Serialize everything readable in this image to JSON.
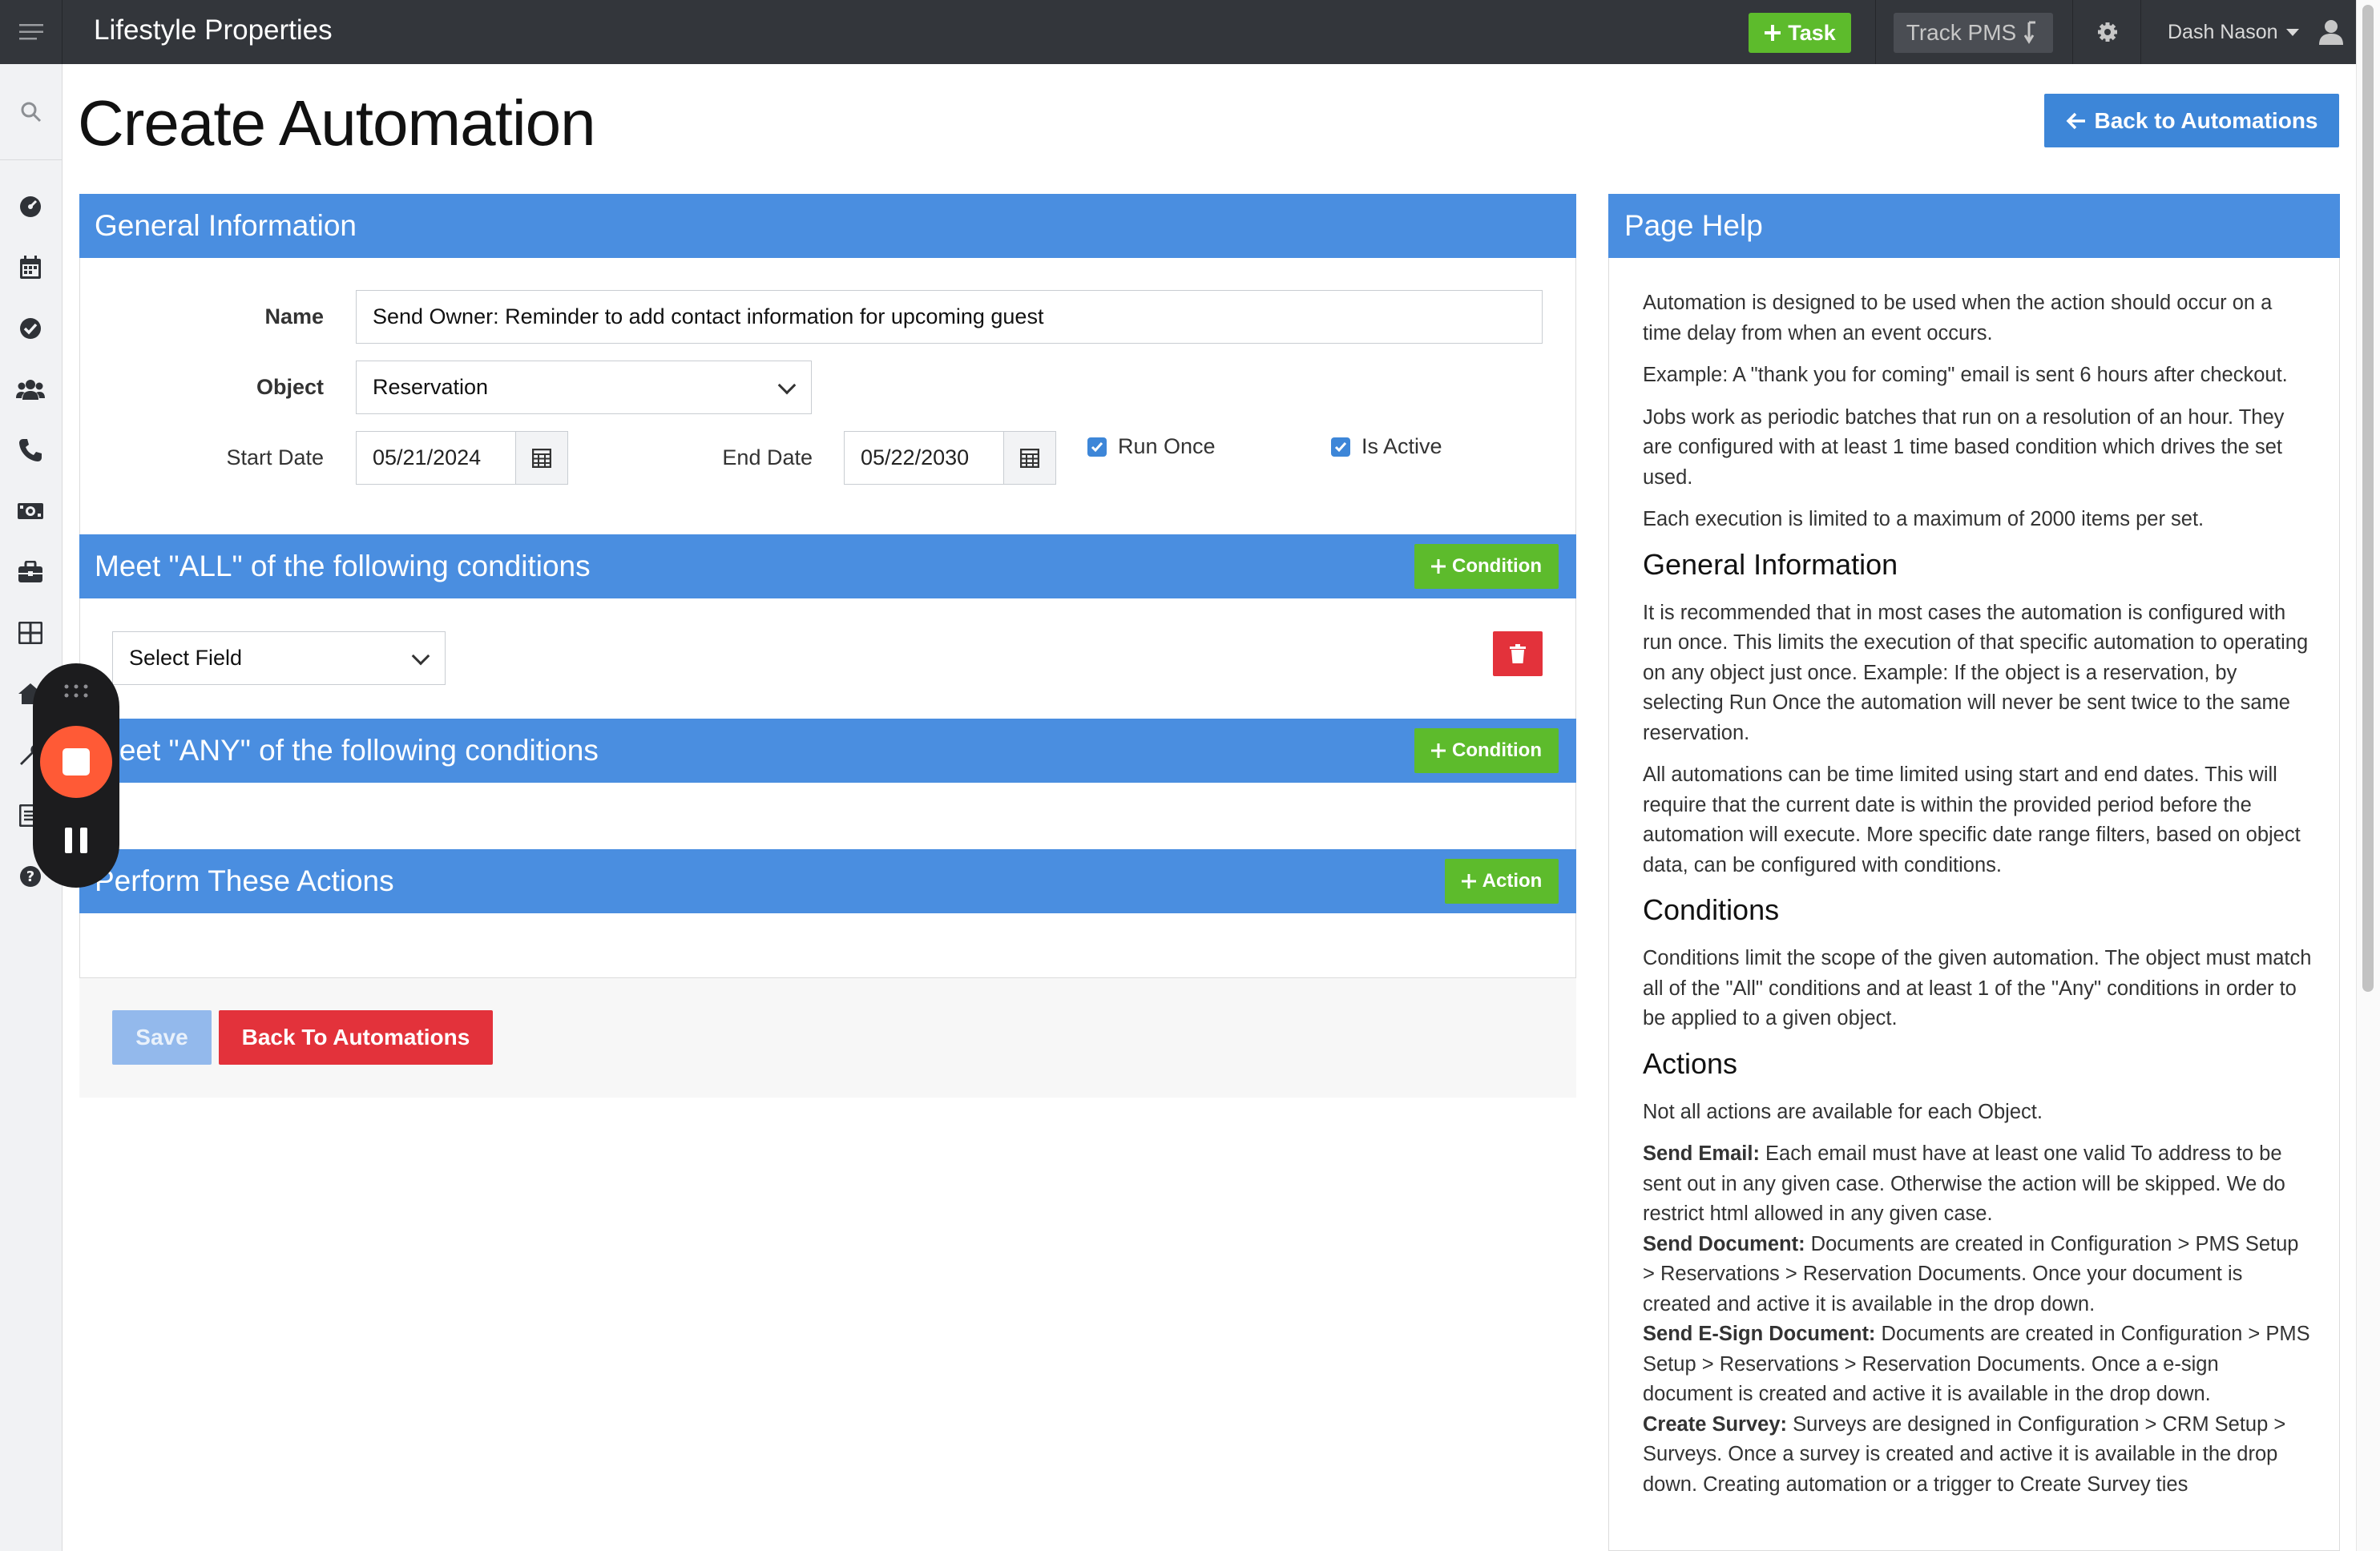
{
  "app": {
    "brand": "Lifestyle Properties",
    "task_label": "Task",
    "track_label": "Track PMS",
    "user_name": "Dash Nason"
  },
  "page": {
    "title": "Create Automation",
    "back_button": "Back to Automations"
  },
  "general": {
    "header": "General Information",
    "name_label": "Name",
    "name_value": "Send Owner: Reminder to add contact information for upcoming guest",
    "object_label": "Object",
    "object_value": "Reservation",
    "start_label": "Start Date",
    "start_value": "05/21/2024",
    "end_label": "End Date",
    "end_value": "05/22/2030",
    "run_once_label": "Run Once",
    "run_once_checked": true,
    "is_active_label": "Is Active",
    "is_active_checked": true
  },
  "conditions_all": {
    "header": "Meet \"ALL\" of the following conditions",
    "add_label": "Condition",
    "field_select": "Select Field"
  },
  "conditions_any": {
    "header": "Meet \"ANY\" of the following conditions",
    "add_label": "Condition"
  },
  "actions": {
    "header": "Perform These Actions",
    "add_label": "Action"
  },
  "footer": {
    "save_label": "Save",
    "back_label": "Back To Automations"
  },
  "help": {
    "header": "Page Help",
    "intro": [
      "Automation is designed to be used when the action should occur on a time delay from when an event occurs.",
      "Example: A \"thank you for coming\" email is sent 6 hours after checkout.",
      "Jobs work as periodic batches that run on a resolution of an hour. They are configured with at least 1 time based condition which drives the set used.",
      "Each execution is limited to a maximum of 2000 items per set."
    ],
    "general_title": "General Information",
    "general_text": [
      "It is recommended that in most cases the automation is configured with run once. This limits the execution of that specific automation to operating on any object just once. Example: If the object is a reservation, by selecting Run Once the automation will never be sent twice to the same reservation.",
      "All automations can be time limited using start and end dates. This will require that the current date is within the provided period before the automation will execute. More specific date range filters, based on object data, can be configured with conditions."
    ],
    "conditions_title": "Conditions",
    "conditions_text": "Conditions limit the scope of the given automation. The object must match all of the \"All\" conditions and at least 1 of the \"Any\" conditions in order to be applied to a given object.",
    "actions_title": "Actions",
    "actions_intro": "Not all actions are available for each Object.",
    "action_items": [
      {
        "term": "Send Email:",
        "text": " Each email must have at least one valid To address to be sent out in any given case. Otherwise the action will be skipped. We do restrict html allowed in any given case."
      },
      {
        "term": "Send Document:",
        "text": " Documents are created in Configuration > PMS Setup > Reservations > Reservation Documents. Once your document is created and active it is available in the drop down."
      },
      {
        "term": "Send E-Sign Document:",
        "text": " Documents are created in Configuration > PMS Setup > Reservations > Reservation Documents. Once a e-sign document is created and active it is available in the drop down."
      },
      {
        "term": "Create Survey:",
        "text": " Surveys are designed in Configuration > CRM Setup > Surveys. Once a survey is created and active it is available in the drop down. Creating automation or a trigger to Create Survey ties"
      }
    ]
  },
  "sidebar": {
    "icons": [
      "search-icon",
      "dashboard-icon",
      "calendar-icon",
      "check-circle-icon",
      "people-icon",
      "phone-icon",
      "money-icon",
      "briefcase-icon",
      "grid-icon",
      "home-icon",
      "wrench-icon",
      "list-icon",
      "help-icon"
    ]
  },
  "colors": {
    "topbar": "#33363b",
    "primary_blue": "#4a8ee0",
    "green": "#5dbb2c",
    "red": "#e3323b",
    "recorder_stop": "#ff5a36"
  }
}
